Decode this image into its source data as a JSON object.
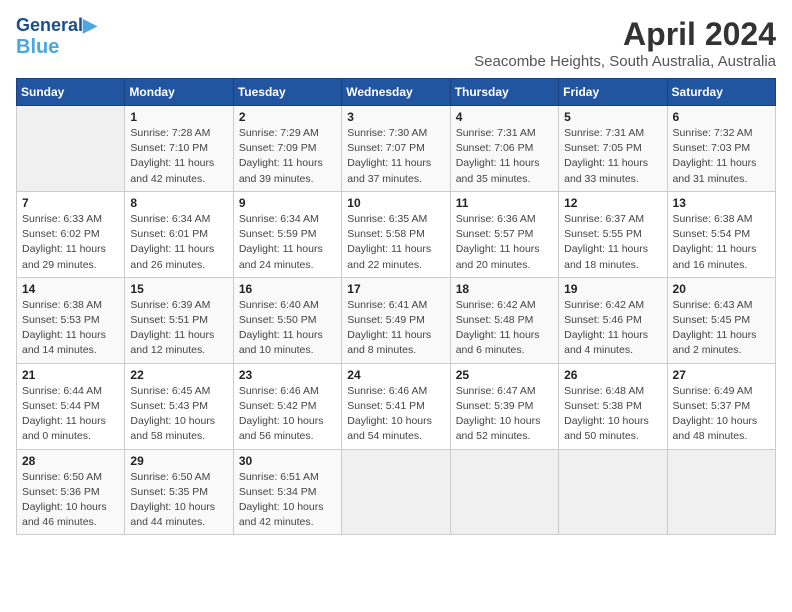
{
  "header": {
    "logo_line1": "General",
    "logo_line2": "Blue",
    "title": "April 2024",
    "location": "Seacombe Heights, South Australia, Australia"
  },
  "days_of_week": [
    "Sunday",
    "Monday",
    "Tuesday",
    "Wednesday",
    "Thursday",
    "Friday",
    "Saturday"
  ],
  "weeks": [
    [
      {
        "day": "",
        "info": ""
      },
      {
        "day": "1",
        "info": "Sunrise: 7:28 AM\nSunset: 7:10 PM\nDaylight: 11 hours\nand 42 minutes."
      },
      {
        "day": "2",
        "info": "Sunrise: 7:29 AM\nSunset: 7:09 PM\nDaylight: 11 hours\nand 39 minutes."
      },
      {
        "day": "3",
        "info": "Sunrise: 7:30 AM\nSunset: 7:07 PM\nDaylight: 11 hours\nand 37 minutes."
      },
      {
        "day": "4",
        "info": "Sunrise: 7:31 AM\nSunset: 7:06 PM\nDaylight: 11 hours\nand 35 minutes."
      },
      {
        "day": "5",
        "info": "Sunrise: 7:31 AM\nSunset: 7:05 PM\nDaylight: 11 hours\nand 33 minutes."
      },
      {
        "day": "6",
        "info": "Sunrise: 7:32 AM\nSunset: 7:03 PM\nDaylight: 11 hours\nand 31 minutes."
      }
    ],
    [
      {
        "day": "7",
        "info": "Sunrise: 6:33 AM\nSunset: 6:02 PM\nDaylight: 11 hours\nand 29 minutes."
      },
      {
        "day": "8",
        "info": "Sunrise: 6:34 AM\nSunset: 6:01 PM\nDaylight: 11 hours\nand 26 minutes."
      },
      {
        "day": "9",
        "info": "Sunrise: 6:34 AM\nSunset: 5:59 PM\nDaylight: 11 hours\nand 24 minutes."
      },
      {
        "day": "10",
        "info": "Sunrise: 6:35 AM\nSunset: 5:58 PM\nDaylight: 11 hours\nand 22 minutes."
      },
      {
        "day": "11",
        "info": "Sunrise: 6:36 AM\nSunset: 5:57 PM\nDaylight: 11 hours\nand 20 minutes."
      },
      {
        "day": "12",
        "info": "Sunrise: 6:37 AM\nSunset: 5:55 PM\nDaylight: 11 hours\nand 18 minutes."
      },
      {
        "day": "13",
        "info": "Sunrise: 6:38 AM\nSunset: 5:54 PM\nDaylight: 11 hours\nand 16 minutes."
      }
    ],
    [
      {
        "day": "14",
        "info": "Sunrise: 6:38 AM\nSunset: 5:53 PM\nDaylight: 11 hours\nand 14 minutes."
      },
      {
        "day": "15",
        "info": "Sunrise: 6:39 AM\nSunset: 5:51 PM\nDaylight: 11 hours\nand 12 minutes."
      },
      {
        "day": "16",
        "info": "Sunrise: 6:40 AM\nSunset: 5:50 PM\nDaylight: 11 hours\nand 10 minutes."
      },
      {
        "day": "17",
        "info": "Sunrise: 6:41 AM\nSunset: 5:49 PM\nDaylight: 11 hours\nand 8 minutes."
      },
      {
        "day": "18",
        "info": "Sunrise: 6:42 AM\nSunset: 5:48 PM\nDaylight: 11 hours\nand 6 minutes."
      },
      {
        "day": "19",
        "info": "Sunrise: 6:42 AM\nSunset: 5:46 PM\nDaylight: 11 hours\nand 4 minutes."
      },
      {
        "day": "20",
        "info": "Sunrise: 6:43 AM\nSunset: 5:45 PM\nDaylight: 11 hours\nand 2 minutes."
      }
    ],
    [
      {
        "day": "21",
        "info": "Sunrise: 6:44 AM\nSunset: 5:44 PM\nDaylight: 11 hours\nand 0 minutes."
      },
      {
        "day": "22",
        "info": "Sunrise: 6:45 AM\nSunset: 5:43 PM\nDaylight: 10 hours\nand 58 minutes."
      },
      {
        "day": "23",
        "info": "Sunrise: 6:46 AM\nSunset: 5:42 PM\nDaylight: 10 hours\nand 56 minutes."
      },
      {
        "day": "24",
        "info": "Sunrise: 6:46 AM\nSunset: 5:41 PM\nDaylight: 10 hours\nand 54 minutes."
      },
      {
        "day": "25",
        "info": "Sunrise: 6:47 AM\nSunset: 5:39 PM\nDaylight: 10 hours\nand 52 minutes."
      },
      {
        "day": "26",
        "info": "Sunrise: 6:48 AM\nSunset: 5:38 PM\nDaylight: 10 hours\nand 50 minutes."
      },
      {
        "day": "27",
        "info": "Sunrise: 6:49 AM\nSunset: 5:37 PM\nDaylight: 10 hours\nand 48 minutes."
      }
    ],
    [
      {
        "day": "28",
        "info": "Sunrise: 6:50 AM\nSunset: 5:36 PM\nDaylight: 10 hours\nand 46 minutes."
      },
      {
        "day": "29",
        "info": "Sunrise: 6:50 AM\nSunset: 5:35 PM\nDaylight: 10 hours\nand 44 minutes."
      },
      {
        "day": "30",
        "info": "Sunrise: 6:51 AM\nSunset: 5:34 PM\nDaylight: 10 hours\nand 42 minutes."
      },
      {
        "day": "",
        "info": ""
      },
      {
        "day": "",
        "info": ""
      },
      {
        "day": "",
        "info": ""
      },
      {
        "day": "",
        "info": ""
      }
    ]
  ]
}
